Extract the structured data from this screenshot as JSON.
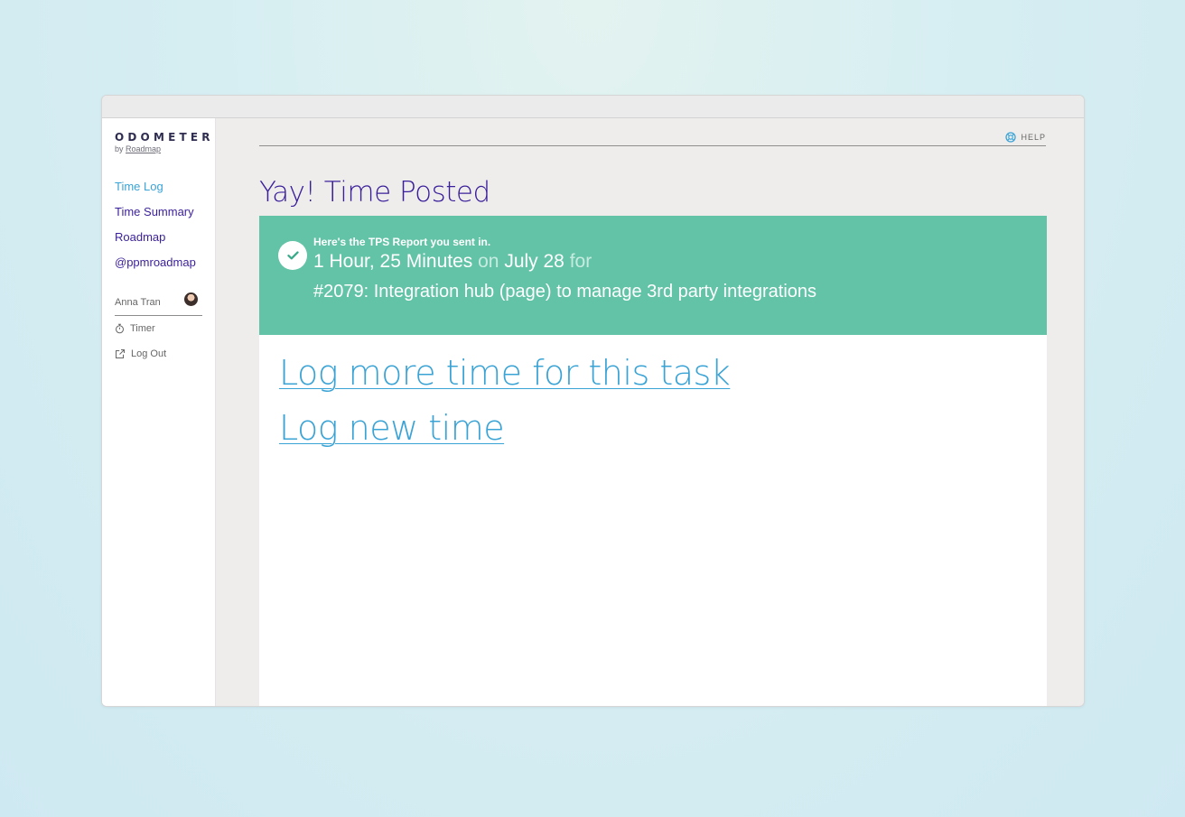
{
  "brand": {
    "name": "ODOMETER",
    "by_prefix": "by",
    "by_link": "Roadmap"
  },
  "nav": {
    "items": [
      {
        "label": "Time Log",
        "active": true
      },
      {
        "label": "Time Summary",
        "active": false
      },
      {
        "label": "Roadmap",
        "active": false
      },
      {
        "label": "@ppmroadmap",
        "active": false
      }
    ]
  },
  "user": {
    "name": "Anna Tran"
  },
  "links": {
    "timer": "Timer",
    "logout": "Log Out"
  },
  "header": {
    "help": "HELP"
  },
  "page": {
    "title": "Yay! Time Posted"
  },
  "banner": {
    "subtitle": "Here's the TPS Report you sent in.",
    "duration": "1 Hour, 25 Minutes",
    "on_word": "on",
    "date": "July 28",
    "for_word": "for",
    "task": "#2079: Integration hub (page) to manage 3rd party integrations"
  },
  "actions": {
    "log_more": "Log more time for this task",
    "log_new": "Log new time"
  },
  "colors": {
    "accent": "#3aa3d6",
    "primary": "#3a1f9a",
    "success": "#63c3a7"
  }
}
